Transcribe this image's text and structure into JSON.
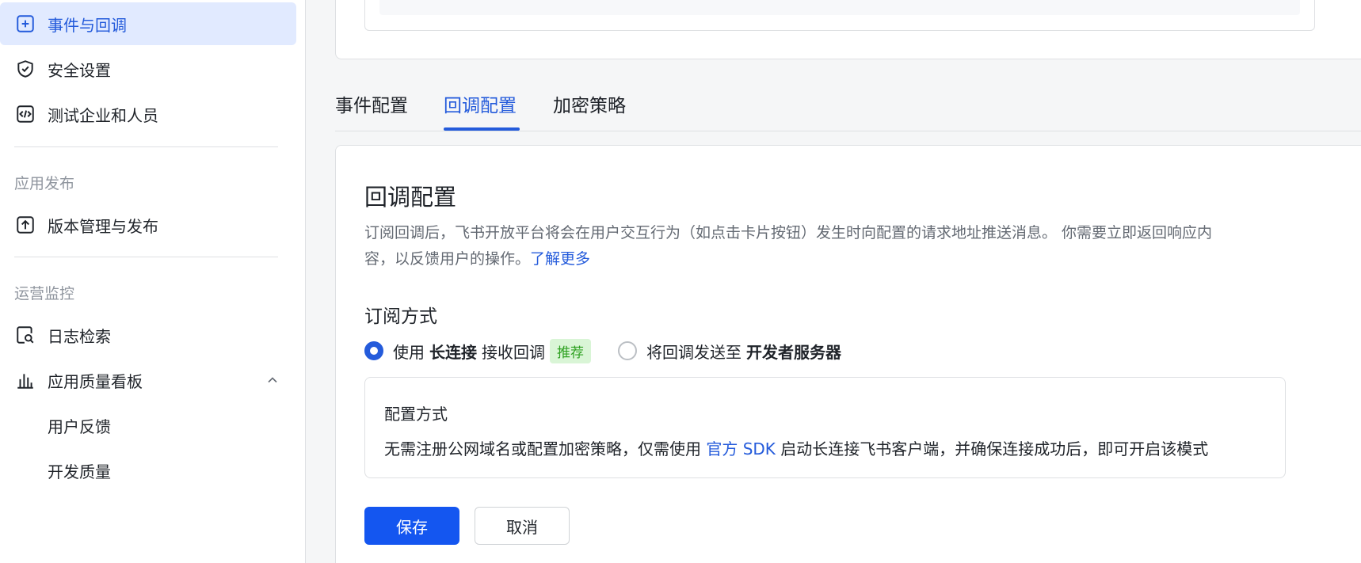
{
  "sidebar": {
    "items": [
      {
        "label": "事件与回调",
        "icon": "add-box-icon",
        "active": true
      },
      {
        "label": "安全设置",
        "icon": "shield-check-icon"
      },
      {
        "label": "测试企业和人员",
        "icon": "code-box-icon"
      }
    ],
    "group_publish": "应用发布",
    "publish_items": [
      {
        "label": "版本管理与发布",
        "icon": "upload-box-icon"
      }
    ],
    "group_ops": "运营监控",
    "ops_items": [
      {
        "label": "日志检索",
        "icon": "doc-search-icon"
      },
      {
        "label": "应用质量看板",
        "icon": "bar-chart-icon",
        "expanded": true
      }
    ],
    "sub_items": [
      {
        "label": "用户反馈"
      },
      {
        "label": "开发质量"
      }
    ]
  },
  "tabs": [
    {
      "label": "事件配置"
    },
    {
      "label": "回调配置",
      "active": true
    },
    {
      "label": "加密策略"
    }
  ],
  "main": {
    "title": "回调配置",
    "description_line1": "订阅回调后，飞书开放平台将会在用户交互行为（如点击卡片按钮）发生时向配置的请求地址推送消息。 你需要立即返回响应内",
    "description_line2": "容，以反馈用户的操作。",
    "learn_more": "了解更多",
    "subscribe_label": "订阅方式",
    "option1": {
      "prefix": "使用",
      "bold": "长连接",
      "suffix": "接收回调",
      "tag": "推荐",
      "checked": true
    },
    "option2": {
      "prefix": "将回调发送至",
      "bold": "开发者服务器",
      "checked": false
    },
    "info": {
      "title": "配置方式",
      "text_before": "无需注册公网域名或配置加密策略，仅需使用",
      "link": "官方 SDK",
      "text_after": "启动长连接飞书客户端，并确保连接成功后，即可开启该模式"
    },
    "save_label": "保存",
    "cancel_label": "取消"
  },
  "colors": {
    "accent": "#245bdb",
    "primary_button": "#1456f0",
    "active_nav_bg": "#e1eaff",
    "tag_bg": "#d9f5d6",
    "tag_text": "#2ea121"
  }
}
